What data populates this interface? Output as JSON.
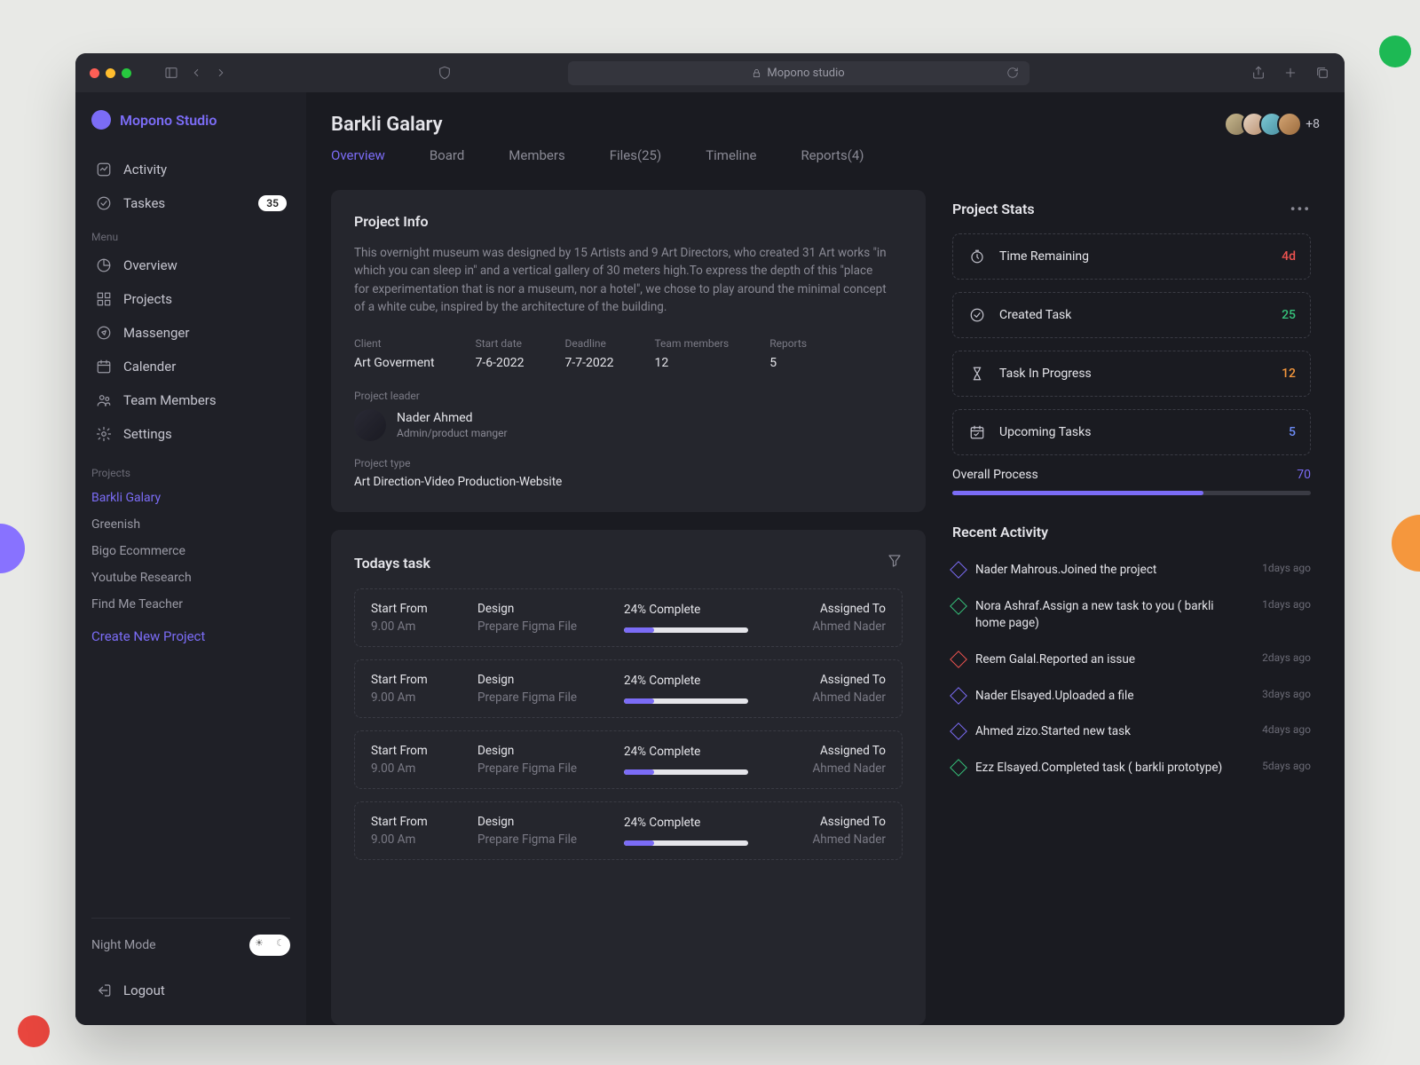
{
  "browser": {
    "url": "Mopono studio"
  },
  "brand": "Mopono Studio",
  "sidebar": {
    "activity": "Activity",
    "tasks": "Taskes",
    "tasks_count": "35",
    "menu_label": "Menu",
    "overview": "Overview",
    "projects": "Projects",
    "messenger": "Massenger",
    "calendar": "Calender",
    "team": "Team Members",
    "settings": "Settings",
    "projects_label": "Projects",
    "proj_items": [
      "Barkli Galary",
      "Greenish",
      "Bigo Ecommerce",
      "Youtube Research",
      "Find Me Teacher"
    ],
    "create": "Create New Project",
    "night": "Night Mode",
    "logout": "Logout"
  },
  "header": {
    "title": "Barkli Galary",
    "more": "+8",
    "tabs": [
      "Overview",
      "Board",
      "Members",
      "Files(25)",
      "Timeline",
      "Reports(4)"
    ]
  },
  "project_info": {
    "title": "Project Info",
    "desc": "This overnight museum was designed by 15 Artists and 9 Art Directors, who created 31 Art works \"in which you can sleep in\" and a vertical gallery of 30 meters high.To express the depth of this \"place for experimentation that is nor a museum, nor a hotel\", we chose to play around the minimal concept of a white cube, inspired by the architecture of the building.",
    "client_lbl": "Client",
    "client": "Art Goverment",
    "start_lbl": "Start date",
    "start": "7-6-2022",
    "deadline_lbl": "Deadline",
    "deadline": "7-7-2022",
    "members_lbl": "Team members",
    "members": "12",
    "reports_lbl": "Reports",
    "reports": "5",
    "leader_lbl": "Project leader",
    "leader_name": "Nader Ahmed",
    "leader_role": "Admin/product manger",
    "type_lbl": "Project type",
    "type": "Art Direction-Video Production-Website"
  },
  "tasks": {
    "title": "Todays task",
    "rows": [
      {
        "start_lbl": "Start From",
        "start": "9.00 Am",
        "design_lbl": "Design",
        "design": "Prepare Figma File",
        "prog": "24% Complete",
        "pct": 24,
        "assign_lbl": "Assigned To",
        "assign": "Ahmed Nader"
      },
      {
        "start_lbl": "Start From",
        "start": "9.00 Am",
        "design_lbl": "Design",
        "design": "Prepare Figma File",
        "prog": "24% Complete",
        "pct": 24,
        "assign_lbl": "Assigned To",
        "assign": "Ahmed Nader"
      },
      {
        "start_lbl": "Start From",
        "start": "9.00 Am",
        "design_lbl": "Design",
        "design": "Prepare Figma File",
        "prog": "24% Complete",
        "pct": 24,
        "assign_lbl": "Assigned To",
        "assign": "Ahmed Nader"
      },
      {
        "start_lbl": "Start From",
        "start": "9.00 Am",
        "design_lbl": "Design",
        "design": "Prepare Figma File",
        "prog": "24% Complete",
        "pct": 24,
        "assign_lbl": "Assigned To",
        "assign": "Ahmed Nader"
      }
    ]
  },
  "stats": {
    "title": "Project Stats",
    "rows": [
      {
        "label": "Time Remaining",
        "value": "4d",
        "cls": "v-red"
      },
      {
        "label": "Created Task",
        "value": "25",
        "cls": "v-green"
      },
      {
        "label": "Task In Progress",
        "value": "12",
        "cls": "v-orange"
      },
      {
        "label": "Upcoming Tasks",
        "value": "5",
        "cls": "v-blue"
      }
    ],
    "overall_lbl": "Overall Process",
    "overall_val": "70",
    "overall_pct": 70
  },
  "activity": {
    "title": "Recent Activity",
    "rows": [
      {
        "dia": "dia-purple",
        "text": "Nader Mahrous.Joined the project",
        "time": "1days ago"
      },
      {
        "dia": "dia-green",
        "text": "Nora Ashraf.Assign a new task to you ( barkli home page)",
        "time": "1days ago"
      },
      {
        "dia": "dia-red",
        "text": "Reem Galal.Reported an issue",
        "time": "2days ago"
      },
      {
        "dia": "dia-purple",
        "text": "Nader Elsayed.Uploaded a file",
        "time": "3days ago"
      },
      {
        "dia": "dia-purple",
        "text": "Ahmed zizo.Started new task",
        "time": "4days ago"
      },
      {
        "dia": "dia-green",
        "text": "Ezz Elsayed.Completed task ( barkli prototype)",
        "time": "5days ago"
      }
    ]
  }
}
